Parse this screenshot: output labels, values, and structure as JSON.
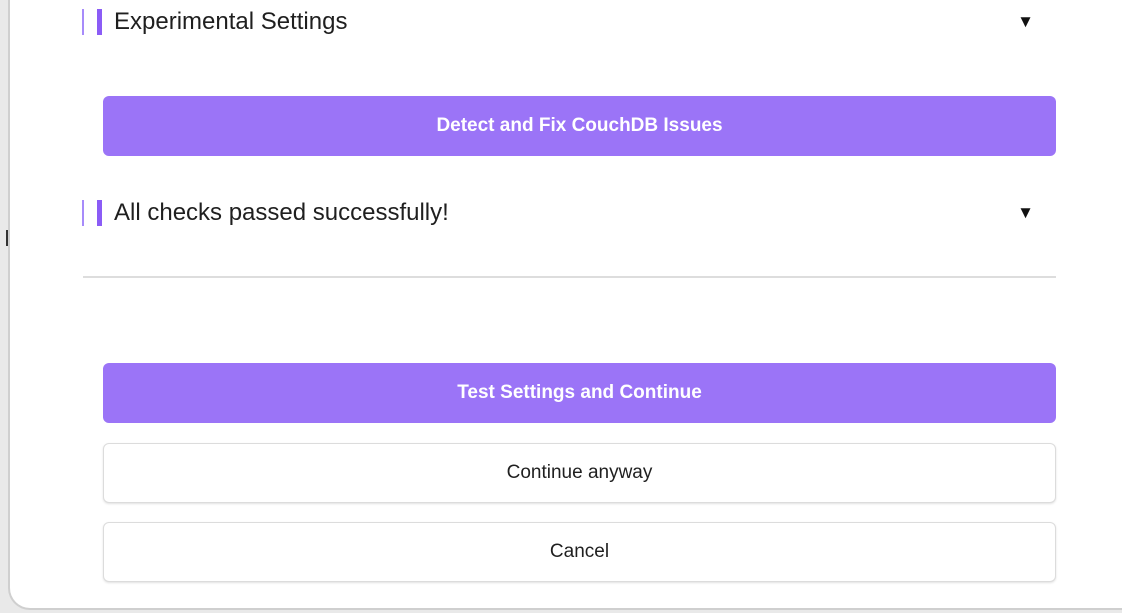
{
  "sections": {
    "experimental": {
      "title": "Experimental Settings",
      "toggle": "▼"
    },
    "checks": {
      "title": "All checks passed successfully!",
      "toggle": "▼"
    }
  },
  "buttons": {
    "detect_fix": "Detect and Fix CouchDB Issues",
    "test_continue": "Test Settings and Continue",
    "continue_anyway": "Continue anyway",
    "cancel": "Cancel"
  },
  "colors": {
    "accent": "#9b74f7",
    "accent_bar": "#8b5cf6"
  }
}
